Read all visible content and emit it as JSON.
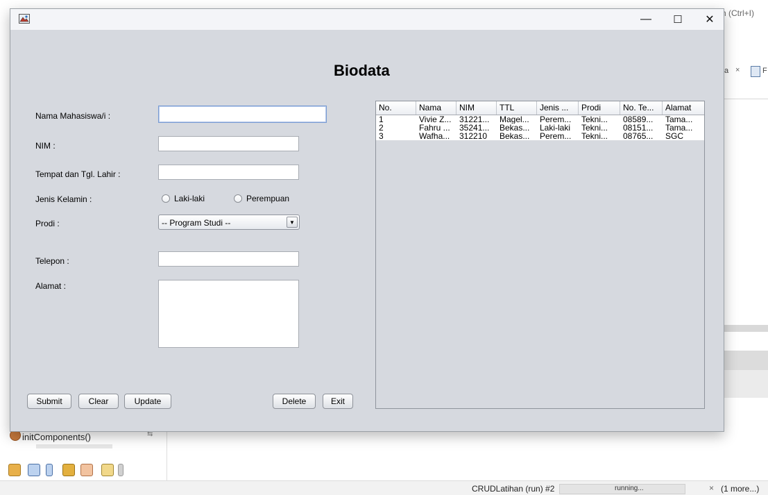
{
  "ide": {
    "search_hint": "h (Ctrl+I)",
    "tab_partial": "a",
    "tab_close": "×",
    "tab_partial2": "F",
    "navigator_item": "initComponents()",
    "status_task": "CRUDLatihan (run) #2",
    "status_state": "running...",
    "status_close": "×",
    "status_more": "(1 more...)"
  },
  "window": {
    "icon": "java-app-icon",
    "minimize": "—",
    "maximize": "☐",
    "close": "✕"
  },
  "form": {
    "title": "Biodata",
    "labels": {
      "nama": "Nama Mahasiswa/i :",
      "nim": "NIM :",
      "ttl": "Tempat dan Tgl. Lahir :",
      "jk": "Jenis Kelamin :",
      "prodi": "Prodi :",
      "telepon": "Telepon :",
      "alamat": "Alamat :"
    },
    "values": {
      "nama": "",
      "nim": "",
      "ttl": "",
      "telepon": "",
      "alamat": ""
    },
    "radio": {
      "male": "Laki-laki",
      "female": "Perempuan"
    },
    "prodi_selected": "-- Program Studi --",
    "buttons": {
      "submit": "Submit",
      "clear": "Clear",
      "update": "Update",
      "delete": "Delete",
      "exit": "Exit"
    }
  },
  "table": {
    "headers": [
      "No.",
      "Nama",
      "NIM",
      "TTL",
      "Jenis ...",
      "Prodi",
      "No. Te...",
      "Alamat"
    ],
    "rows": [
      [
        "1",
        "Vivie Z...",
        "31221...",
        "Magel...",
        "Perem...",
        "Tekni...",
        "08589...",
        "Tama..."
      ],
      [
        "2",
        "Fahru ...",
        "35241...",
        "Bekas...",
        "Laki-laki",
        "Tekni...",
        "08151...",
        "Tama..."
      ],
      [
        "3",
        "Wafha...",
        "312210",
        "Bekas...",
        "Perem...",
        "Tekni...",
        "08765...",
        "SGC"
      ]
    ]
  }
}
